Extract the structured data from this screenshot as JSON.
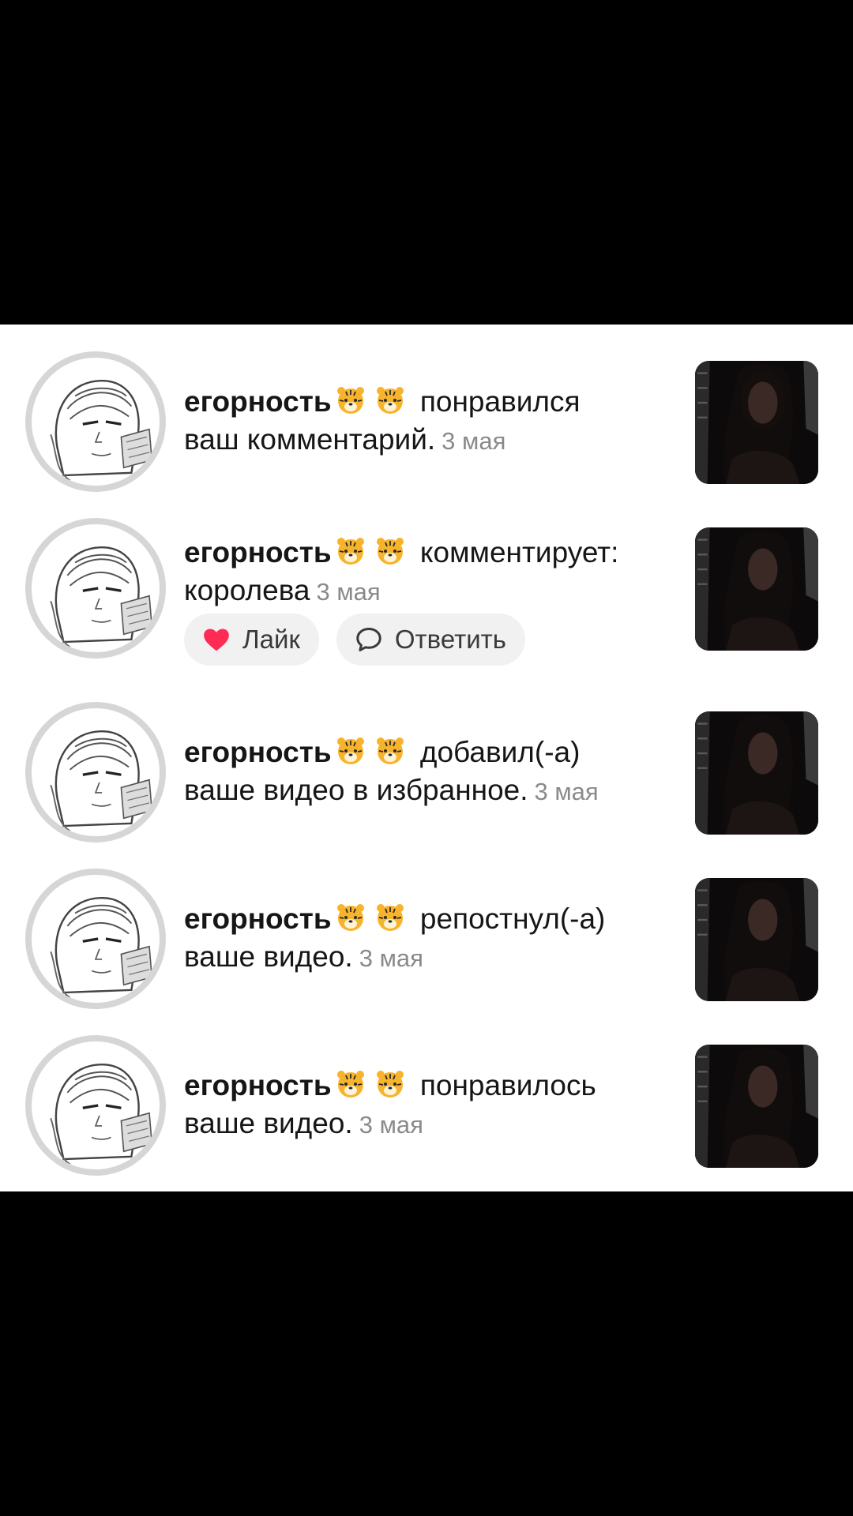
{
  "notifications": [
    {
      "username": "егорность",
      "emoji": [
        "tiger-face-emoji",
        "tiger-face-emoji"
      ],
      "action_line1": "понравился",
      "action_line2": "ваш комментарий.",
      "date": "3 мая"
    },
    {
      "username": "егорность",
      "emoji": [
        "tiger-face-emoji",
        "tiger-face-emoji"
      ],
      "action_line1": "комментирует:",
      "action_line2": "королева",
      "date": "3 мая",
      "like_label": "Лайк",
      "reply_label": "Ответить"
    },
    {
      "username": "егорность",
      "emoji": [
        "tiger-face-emoji",
        "tiger-face-emoji"
      ],
      "action_line1": "добавил(-а)",
      "action_line2": "ваше видео в избранное.",
      "date": "3 мая"
    },
    {
      "username": "егорность",
      "emoji": [
        "tiger-face-emoji",
        "tiger-face-emoji"
      ],
      "action_line1": "репостнул(-а)",
      "action_line2": "ваше видео.",
      "date": "3 мая"
    },
    {
      "username": "егорность",
      "emoji": [
        "tiger-face-emoji",
        "tiger-face-emoji"
      ],
      "action_line1": "понравилось",
      "action_line2": "ваше видео.",
      "date": "3 мая"
    }
  ],
  "colors": {
    "background": "#000000",
    "panel": "#ffffff",
    "text": "#161616",
    "date": "#8a8a8a",
    "pill": "#f1f1f2",
    "heart": "#fe2c55"
  },
  "icons": {
    "like": "heart-icon",
    "reply": "speech-bubble-icon"
  }
}
